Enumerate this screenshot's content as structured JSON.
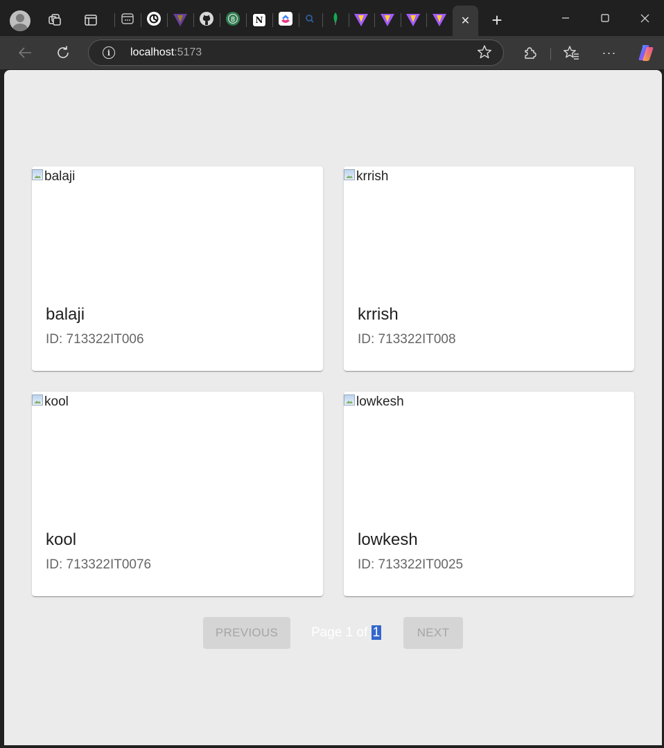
{
  "browser": {
    "tabs": [
      {
        "icon": "workspaces-icon"
      },
      {
        "icon": "tab-actions-icon"
      },
      {
        "icon": "app-icon"
      },
      {
        "icon": "chatgpt-icon"
      },
      {
        "icon": "vite-icon"
      },
      {
        "icon": "github-icon"
      },
      {
        "icon": "whatsapp-icon",
        "badge": "8"
      },
      {
        "icon": "notion-icon",
        "text": "N"
      },
      {
        "icon": "clickup-icon"
      },
      {
        "icon": "search-icon"
      },
      {
        "icon": "mongodb-icon"
      },
      {
        "icon": "vite-icon"
      },
      {
        "icon": "vite-icon"
      },
      {
        "icon": "vite-icon"
      },
      {
        "icon": "vite-icon"
      }
    ],
    "address": {
      "host": "localhost",
      "port": ":5173"
    }
  },
  "cards": [
    {
      "alt": "balaji",
      "name": "balaji",
      "id_text": "ID: 713322IT006"
    },
    {
      "alt": "krrish",
      "name": "krrish",
      "id_text": "ID: 713322IT008"
    },
    {
      "alt": "kool",
      "name": "kool",
      "id_text": "ID: 713322IT0076"
    },
    {
      "alt": "lowkesh",
      "name": "lowkesh",
      "id_text": "ID: 713322IT0025"
    }
  ],
  "pagination": {
    "previous_label": "PREVIOUS",
    "next_label": "NEXT",
    "page_prefix": "Page 1 of ",
    "page_total": "1"
  }
}
